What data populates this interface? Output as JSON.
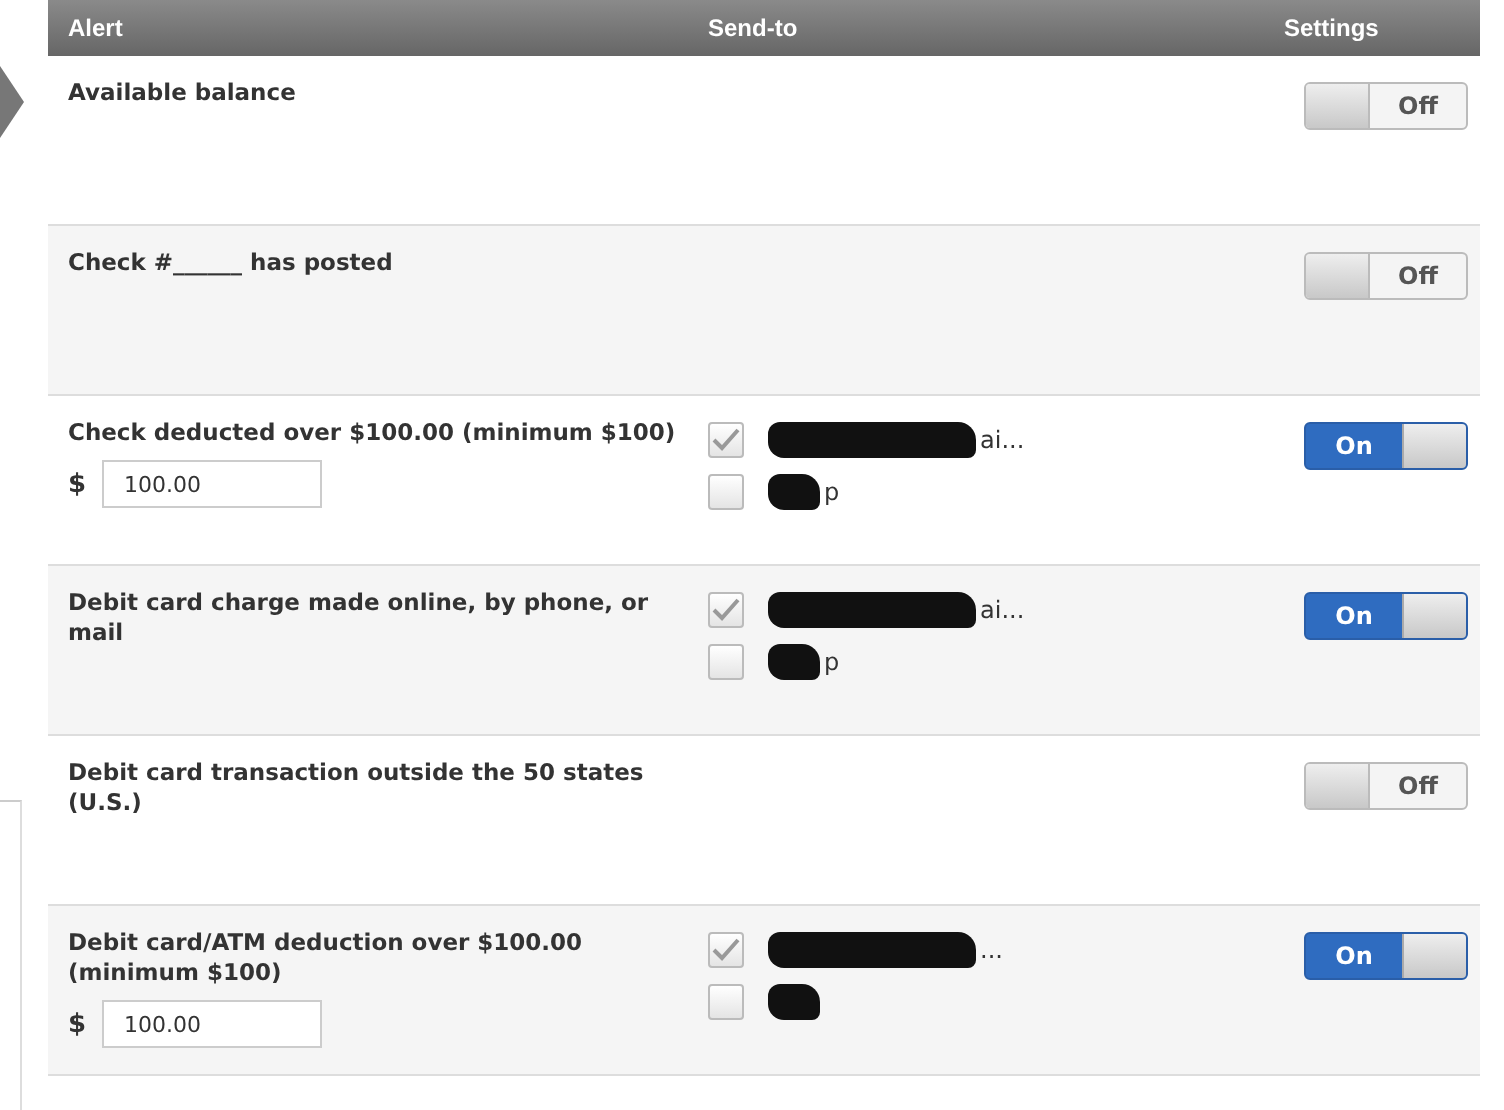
{
  "table": {
    "columns": [
      "Alert",
      "Send-to",
      "Settings"
    ],
    "rows": [
      {
        "alert": "Available balance",
        "on": false,
        "toggle_label": "Off"
      },
      {
        "alert": "Check #______ has posted",
        "on": false,
        "toggle_label": "Off"
      },
      {
        "alert": "Check deducted over $100.00 (minimum $100)",
        "amount": {
          "currency": "$",
          "value": "100.00"
        },
        "recipients": [
          {
            "checked": true,
            "text": "ai..."
          },
          {
            "checked": false,
            "text": "p"
          }
        ],
        "on": true,
        "toggle_label": "On"
      },
      {
        "alert": "Debit card charge made online, by phone, or mail",
        "recipients": [
          {
            "checked": true,
            "text": "ai..."
          },
          {
            "checked": false,
            "text": "p"
          }
        ],
        "on": true,
        "toggle_label": "On"
      },
      {
        "alert": "Debit card transaction outside the 50 states (U.S.)",
        "on": false,
        "toggle_label": "Off"
      },
      {
        "alert": "Debit card/ATM deduction over $100.00 (minimum $100)",
        "amount": {
          "currency": "$",
          "value": "100.00"
        },
        "recipients": [
          {
            "checked": true,
            "text": "..."
          },
          {
            "checked": false
          }
        ],
        "on": true,
        "toggle_label": "On"
      }
    ]
  }
}
